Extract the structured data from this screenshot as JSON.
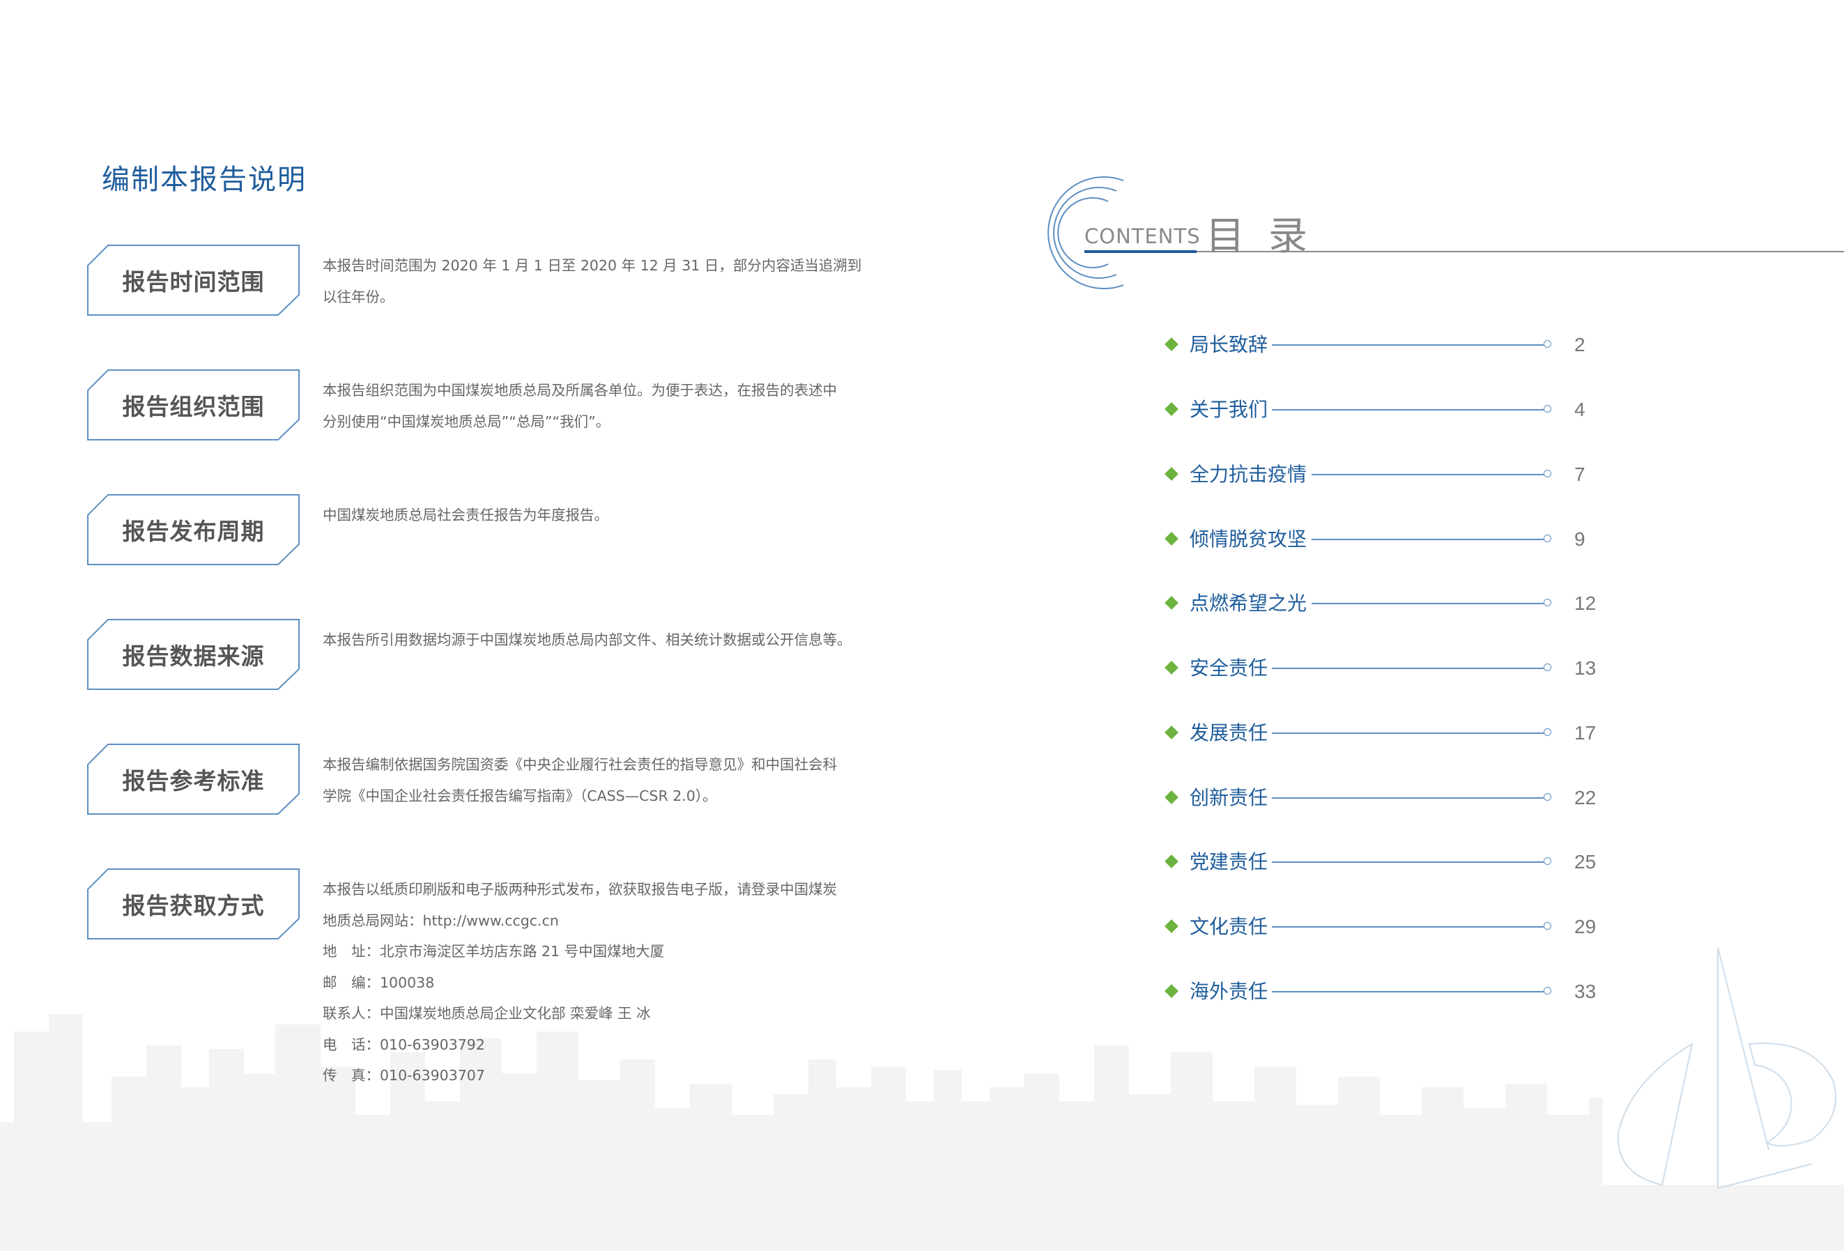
{
  "left": {
    "title": "编制本报告说明",
    "sections": [
      {
        "label": "报告时间范围",
        "lines": [
          "本报告时间范围为 2020 年 1 月 1 日至 2020 年 12 月 31 日，部分内容适当追溯到",
          "以往年份。"
        ]
      },
      {
        "label": "报告组织范围",
        "lines": [
          "本报告组织范围为中国煤炭地质总局及所属各单位。为便于表达，在报告的表述中",
          "分别使用“中国煤炭地质总局”“总局”“我们”。"
        ]
      },
      {
        "label": "报告发布周期",
        "lines": [
          "中国煤炭地质总局社会责任报告为年度报告。"
        ]
      },
      {
        "label": "报告数据来源",
        "lines": [
          "本报告所引用数据均源于中国煤炭地质总局内部文件、相关统计数据或公开信息等。"
        ]
      },
      {
        "label": "报告参考标准",
        "lines": [
          "本报告编制依据国务院国资委《中央企业履行社会责任的指导意见》和中国社会科",
          "学院《中国企业社会责任报告编写指南》（CASS—CSR 2.0）。"
        ]
      },
      {
        "label": "报告获取方式",
        "lines": [
          "本报告以纸质印刷版和电子版两种形式发布，欲获取报告电子版，请登录中国煤炭",
          "地质总局网站：http://www.ccgc.cn",
          "地　址：北京市海淀区羊坊店东路 21 号中国煤地大厦",
          "邮　编：100038",
          "联系人：中国煤炭地质总局企业文化部  栾爱峰   王  冰",
          "电　话：010-63903792",
          "传　真：010-63903707"
        ]
      }
    ]
  },
  "right": {
    "contents_word": "CONTENTS",
    "mulu": [
      "目",
      "录"
    ],
    "toc": [
      {
        "label": "局长致辞",
        "page": "2"
      },
      {
        "label": "关于我们",
        "page": "4"
      },
      {
        "label": "全力抗击疫情",
        "page": "7"
      },
      {
        "label": "倾情脱贫攻坚",
        "page": "9"
      },
      {
        "label": "点燃希望之光",
        "page": "12"
      },
      {
        "label": "安全责任",
        "page": "13"
      },
      {
        "label": "发展责任",
        "page": "17"
      },
      {
        "label": "创新责任",
        "page": "22"
      },
      {
        "label": "党建责任",
        "page": "25"
      },
      {
        "label": "文化责任",
        "page": "29"
      },
      {
        "label": "海外责任",
        "page": "33"
      }
    ]
  },
  "colors": {
    "title_blue": "#1f5d9c",
    "bullet_green": "#6cb33f",
    "line_blue": "#5c8fc2",
    "skyline_gray": "#f2f2f2"
  },
  "icons": [
    "contents-ring-icon",
    "company-logo-watermark-icon",
    "diamond-bullet-icon"
  ]
}
